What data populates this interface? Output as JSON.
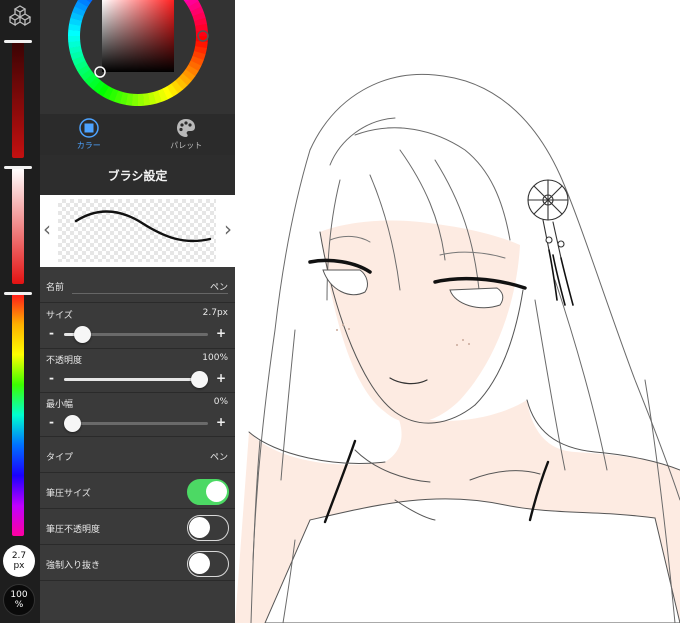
{
  "colors": {
    "rail_bg": "#1e1e1e",
    "panel_bg": "#3a3a3a",
    "accent_blue": "#4da3ff",
    "toggle_on": "#4cd964",
    "skin": "#fdebe2"
  },
  "rail": {
    "logo_icon": "cube-stack-icon",
    "brush_size": {
      "value": "2.7",
      "unit": "px"
    },
    "brush_opacity": {
      "value": "100",
      "unit": "%"
    }
  },
  "color_tabs": [
    {
      "label": "カラー",
      "icon": "color-square-icon",
      "active": true
    },
    {
      "label": "パレット",
      "icon": "palette-icon",
      "active": false
    }
  ],
  "brush_settings": {
    "title": "ブラシ設定",
    "name_label": "名前",
    "name_value": "ペン",
    "size": {
      "label": "サイズ",
      "value": "2.7px",
      "level": 0.08
    },
    "opacity": {
      "label": "不透明度",
      "value": "100%",
      "level": 1.0
    },
    "min_width": {
      "label": "最小幅",
      "value": "0%",
      "level": 0.0
    },
    "type": {
      "label": "タイプ",
      "value": "ペン"
    },
    "toggles": [
      {
        "label": "筆圧サイズ",
        "on": true
      },
      {
        "label": "筆圧不透明度",
        "on": false
      },
      {
        "label": "強制入り抜き",
        "on": false
      }
    ],
    "minus_symbol": "-",
    "plus_symbol": "+",
    "prev_symbol": "‹",
    "next_symbol": "›"
  }
}
